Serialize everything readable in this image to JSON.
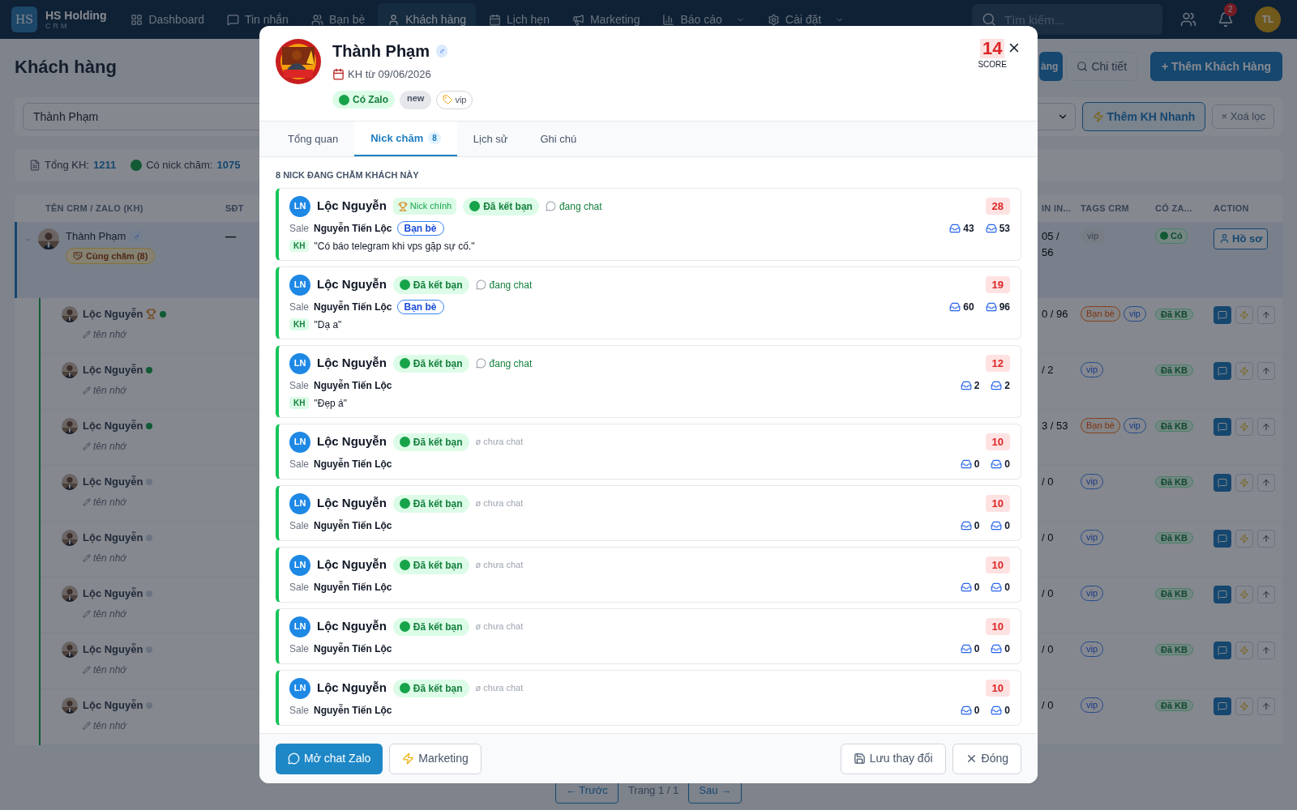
{
  "nav": {
    "brand": {
      "logo": "HS",
      "name": "HS Holding",
      "sub": "CRM"
    },
    "items": [
      {
        "label": "Dashboard",
        "selected": false,
        "dropdown": false
      },
      {
        "label": "Tin nhắn",
        "selected": false,
        "dropdown": false
      },
      {
        "label": "Bạn bè",
        "selected": false,
        "dropdown": false
      },
      {
        "label": "Khách hàng",
        "selected": true,
        "dropdown": false
      },
      {
        "label": "Lịch hẹn",
        "selected": false,
        "dropdown": false
      },
      {
        "label": "Marketing",
        "selected": false,
        "dropdown": false
      },
      {
        "label": "Báo cáo",
        "selected": false,
        "dropdown": true
      },
      {
        "label": "Cài đặt",
        "selected": false,
        "dropdown": true
      }
    ],
    "search_placeholder": "Tìm kiếm...",
    "notifications": "2",
    "avatar": "TL"
  },
  "page": {
    "title": "Khách hàng",
    "header_buttons": [
      {
        "label": "àng",
        "kind": "primary"
      },
      {
        "label": "Chi tiết",
        "kind": "search"
      },
      {
        "label": "+ Thêm Khách Hàng",
        "kind": "primary"
      }
    ],
    "filters": {
      "search_value": "Thành Phạm",
      "quick_add": "Thêm KH Nhanh",
      "clear": "× Xoá lọc"
    },
    "stats": [
      {
        "kind": "total",
        "label": "Tổng KH:",
        "value": "1211"
      },
      {
        "kind": "nick",
        "label": "Có nick chăm:",
        "value": "1075"
      }
    ],
    "table": {
      "columns": [
        "TÊN CRM / ZALO (KH)",
        "SĐT",
        "IN IN...",
        "TAGS CRM",
        "CÓ ZA...",
        "ACTION"
      ],
      "main_row": {
        "name": "Thành Phạm",
        "gender": "♂",
        "badge": "Cùng chăm (8)",
        "phone": "—",
        "column_3": [
          "05 /",
          "56"
        ],
        "tags": [
          {
            "label": "vip",
            "kind": "gray"
          }
        ],
        "zalo": "Có",
        "action": "Hồ sơ"
      },
      "child_rows": [
        {
          "name": "Lộc Nguyễn",
          "main": true,
          "online": true,
          "note": "tên nhớ",
          "column_3": "0 / 96",
          "tags": [
            {
              "label": "Bạn bè",
              "kind": "orange"
            },
            {
              "label": "vip",
              "kind": "blue"
            }
          ],
          "zalo": "Đã KB"
        },
        {
          "name": "Lộc Nguyễn",
          "main": false,
          "online": true,
          "note": "tên nhớ",
          "column_3": "/ 2",
          "tags": [
            {
              "label": "vip",
              "kind": "blue"
            }
          ],
          "zalo": "Đã KB"
        },
        {
          "name": "Lộc Nguyễn",
          "main": false,
          "online": true,
          "note": "tên nhớ",
          "column_3": "3 / 53",
          "tags": [
            {
              "label": "Bạn bè",
              "kind": "orange"
            },
            {
              "label": "vip",
              "kind": "blue"
            }
          ],
          "zalo": "Đã KB"
        },
        {
          "name": "Lộc Nguyễn",
          "main": false,
          "online": false,
          "note": "tên nhớ",
          "column_3": "/ 0",
          "tags": [
            {
              "label": "vip",
              "kind": "blue"
            }
          ],
          "zalo": "Đã KB"
        },
        {
          "name": "Lộc Nguyễn",
          "main": false,
          "online": false,
          "note": "tên nhớ",
          "column_3": "/ 0",
          "tags": [
            {
              "label": "vip",
              "kind": "blue"
            }
          ],
          "zalo": "Đã KB"
        },
        {
          "name": "Lộc Nguyễn",
          "main": false,
          "online": false,
          "note": "tên nhớ",
          "column_3": "/ 0",
          "tags": [
            {
              "label": "vip",
              "kind": "blue"
            }
          ],
          "zalo": "Đã KB"
        },
        {
          "name": "Lộc Nguyễn",
          "main": false,
          "online": false,
          "note": "tên nhớ",
          "column_3": "/ 0",
          "tags": [
            {
              "label": "vip",
              "kind": "blue"
            }
          ],
          "zalo": "Đã KB"
        },
        {
          "name": "Lộc Nguyễn",
          "main": false,
          "online": false,
          "note": "tên nhớ",
          "column_3": "/ 0",
          "tags": [
            {
              "label": "vip",
              "kind": "blue"
            }
          ],
          "zalo": "Đã KB"
        }
      ]
    },
    "pagination": [
      "← Trước",
      "Trang 1 / 1",
      "Sau →"
    ]
  },
  "modal": {
    "name": "Thành Phạm",
    "gender": "♂",
    "since": "KH từ 09/06/2026",
    "badges": [
      {
        "label": "Có Zalo",
        "kind": "zalo"
      },
      {
        "label": "new",
        "kind": "gray"
      },
      {
        "label": "vip",
        "kind": "tag"
      }
    ],
    "score": "14",
    "score_label": "SCORE",
    "tabs": [
      {
        "label": "Tổng quan",
        "selected": false
      },
      {
        "label": "Nick chăm",
        "count": "8",
        "selected": true
      },
      {
        "label": "Lịch sử",
        "selected": false
      },
      {
        "label": "Ghi chú",
        "selected": false
      }
    ],
    "section_title": "8 NICK ĐANG CHĂM KHÁCH NÀY",
    "nicks": [
      {
        "initials": "LN",
        "name": "Lộc Nguyễn",
        "main_label": "Nick chính",
        "friend": "Đã kết bạn",
        "chat": {
          "kind": "chatting",
          "label": "đang chat"
        },
        "score": "28",
        "sale_label": "Sale",
        "sale": "Nguyễn Tiến Lộc",
        "relation": "Bạn bè",
        "counts": [
          "43",
          "53"
        ],
        "message": {
          "label": "KH",
          "text": "\"Có báo telegram khi vps gặp sự cố.\""
        }
      },
      {
        "initials": "LN",
        "name": "Lộc Nguyễn",
        "friend": "Đã kết bạn",
        "chat": {
          "kind": "chatting",
          "label": "đang chat"
        },
        "score": "19",
        "sale_label": "Sale",
        "sale": "Nguyễn Tiến Lộc",
        "relation": "Bạn bè",
        "counts": [
          "60",
          "96"
        ],
        "message": {
          "label": "KH",
          "text": "\"Dạ a\""
        }
      },
      {
        "initials": "LN",
        "name": "Lộc Nguyễn",
        "friend": "Đã kết bạn",
        "chat": {
          "kind": "chatting",
          "label": "đang chat"
        },
        "score": "12",
        "sale_label": "Sale",
        "sale": "Nguyễn Tiến Lộc",
        "counts": [
          "2",
          "2"
        ],
        "message": {
          "label": "KH",
          "text": "\"Đẹp á\""
        }
      },
      {
        "initials": "LN",
        "name": "Lộc Nguyễn",
        "friend": "Đã kết bạn",
        "chat": {
          "kind": "none",
          "label": "ø chưa chat"
        },
        "score": "10",
        "sale_label": "Sale",
        "sale": "Nguyễn Tiến Lộc",
        "counts": [
          "0",
          "0"
        ]
      },
      {
        "initials": "LN",
        "name": "Lộc Nguyễn",
        "friend": "Đã kết bạn",
        "chat": {
          "kind": "none",
          "label": "ø chưa chat"
        },
        "score": "10",
        "sale_label": "Sale",
        "sale": "Nguyễn Tiến Lộc",
        "counts": [
          "0",
          "0"
        ]
      },
      {
        "initials": "LN",
        "name": "Lộc Nguyễn",
        "friend": "Đã kết bạn",
        "chat": {
          "kind": "none",
          "label": "ø chưa chat"
        },
        "score": "10",
        "sale_label": "Sale",
        "sale": "Nguyễn Tiến Lộc",
        "counts": [
          "0",
          "0"
        ]
      },
      {
        "initials": "LN",
        "name": "Lộc Nguyễn",
        "friend": "Đã kết bạn",
        "chat": {
          "kind": "none",
          "label": "ø chưa chat"
        },
        "score": "10",
        "sale_label": "Sale",
        "sale": "Nguyễn Tiến Lộc",
        "counts": [
          "0",
          "0"
        ]
      },
      {
        "initials": "LN",
        "name": "Lộc Nguyễn",
        "friend": "Đã kết bạn",
        "chat": {
          "kind": "none",
          "label": "ø chưa chat"
        },
        "score": "10",
        "sale_label": "Sale",
        "sale": "Nguyễn Tiến Lộc",
        "counts": [
          "0",
          "0"
        ]
      }
    ],
    "footer_left": [
      {
        "label": "Mở chat Zalo",
        "kind": "primary"
      },
      {
        "label": "Marketing",
        "kind": "outline"
      }
    ],
    "footer_right": [
      {
        "label": "Lưu thay đổi",
        "kind": "outline"
      },
      {
        "label": "Đóng",
        "kind": "outline"
      }
    ]
  }
}
